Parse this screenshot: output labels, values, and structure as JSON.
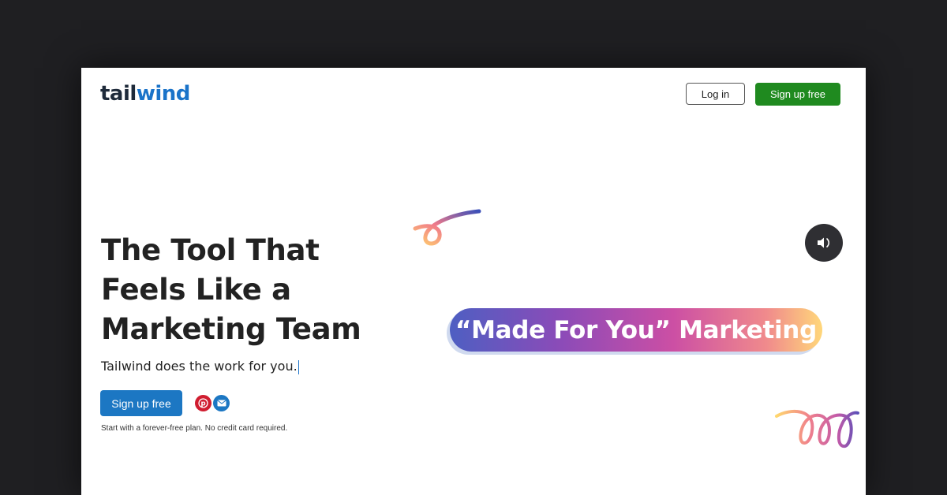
{
  "header": {
    "logo_tail": "tail",
    "logo_wind": "wind",
    "login_label": "Log in",
    "signup_label": "Sign up free"
  },
  "hero": {
    "headline": "The Tool That Feels Like a Marketing Team",
    "subheadline": "Tailwind does the work for you.",
    "cta_label": "Sign up free",
    "disclaimer": "Start with a forever-free plan. No credit card required."
  },
  "video": {
    "banner_text": "“Made For You” Marketing",
    "sound_icon": "speaker-icon"
  },
  "social": {
    "icons": [
      "pinterest-icon",
      "email-icon"
    ]
  },
  "colors": {
    "signup_top": "#1f8a1f",
    "signup_main": "#1c77c3",
    "logo_wind": "#1a73c9",
    "pinterest": "#d01d30"
  }
}
